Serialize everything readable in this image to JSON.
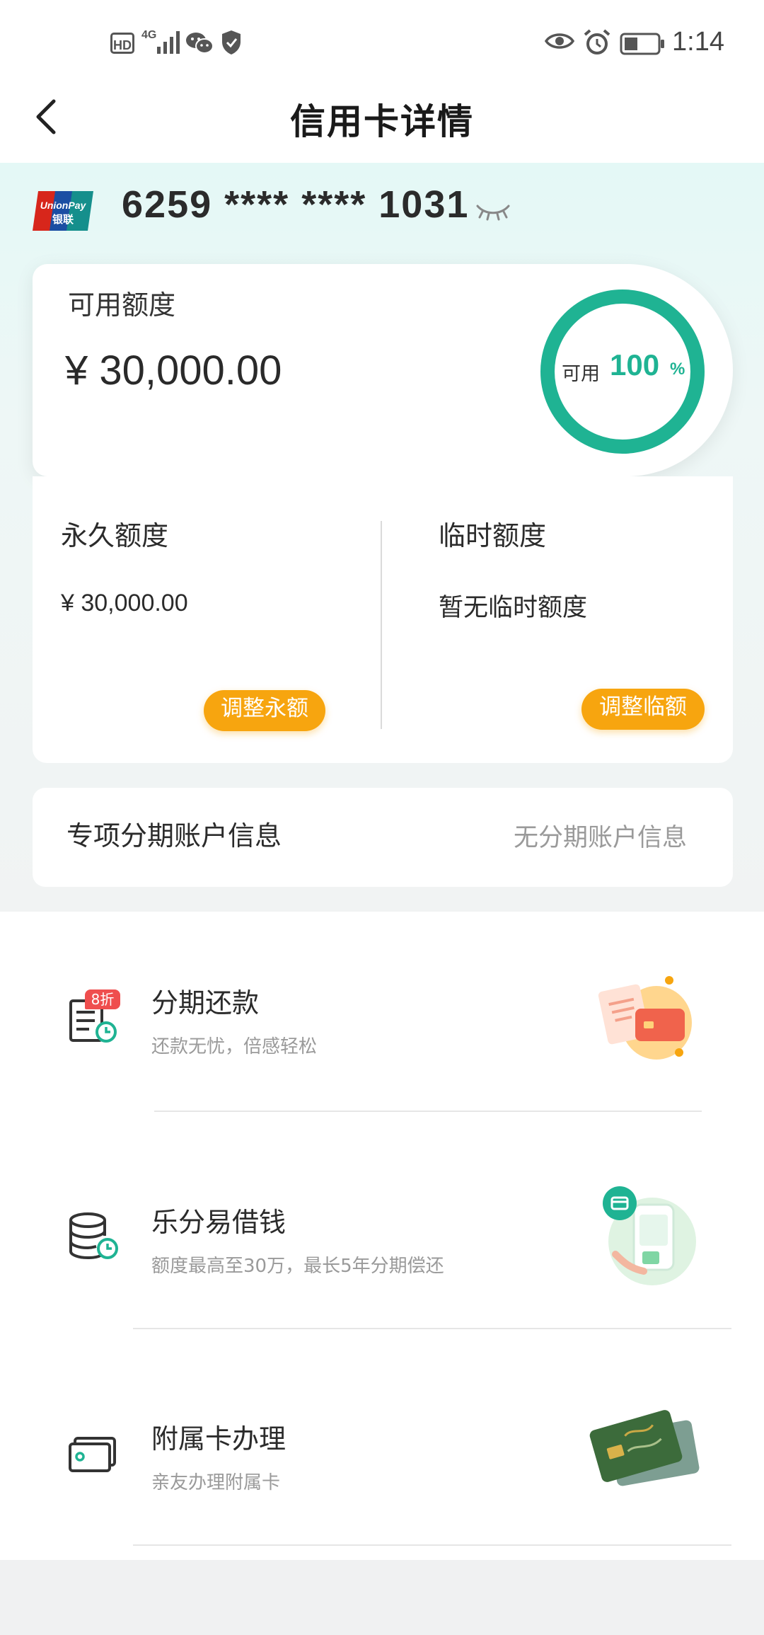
{
  "status_bar": {
    "hd": "HD",
    "network": "4G",
    "time": "1:14",
    "icons": [
      "signal-icon",
      "wechat-icon",
      "shield-icon",
      "eye-icon",
      "alarm-icon",
      "battery-icon"
    ]
  },
  "header": {
    "title": "信用卡详情",
    "back_icon": "chevron-left-icon"
  },
  "card": {
    "brand_icon": "unionpay-logo",
    "brand_text_top": "UnionPay",
    "brand_text_bottom": "银联",
    "number": "6259 **** **** 1031",
    "visibility_icon": "eye-closed-icon"
  },
  "available": {
    "label": "可用额度",
    "amount": "¥ 30,000.00",
    "ring_label": "可用",
    "ring_percent": "100",
    "ring_percent_sign": "%",
    "ring_fraction": 1.0,
    "ring_color": "#1fb393"
  },
  "limits": {
    "permanent": {
      "label": "永久额度",
      "amount": "¥ 30,000.00",
      "button": "调整永额"
    },
    "temporary": {
      "label": "临时额度",
      "amount": "暂无临时额度",
      "button": "调整临额"
    },
    "button_color": "#f7a50f"
  },
  "installment_account": {
    "label": "专项分期账户信息",
    "value": "无分期账户信息"
  },
  "services": [
    {
      "title": "分期还款",
      "subtitle": "还款无忧，倍感轻松",
      "icon": "installment-repay-icon",
      "badge": "8折",
      "illustration": "card-receipt-illustration"
    },
    {
      "title": "乐分易借钱",
      "subtitle": "额度最高至30万，最长5年分期偿还",
      "icon": "coin-stack-clock-icon",
      "illustration": "phone-payment-illustration"
    },
    {
      "title": "附属卡办理",
      "subtitle": "亲友办理附属卡",
      "icon": "card-icon",
      "illustration": "credit-cards-illustration"
    }
  ]
}
